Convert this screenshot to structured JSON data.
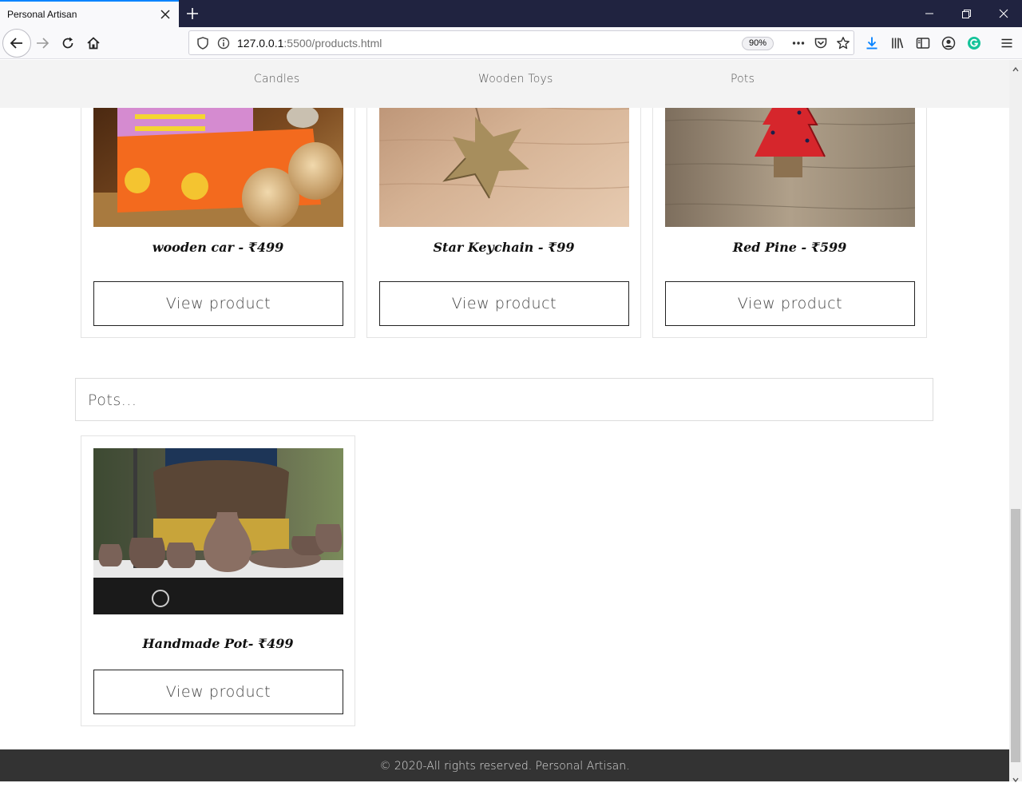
{
  "browser": {
    "tab_title": "Personal Artisan",
    "url_host": "127.0.0.1",
    "url_path": ":5500/products.html",
    "zoom": "90%"
  },
  "nav": {
    "items": [
      "Candles",
      "Wooden Toys",
      "Pots"
    ]
  },
  "products_top": [
    {
      "title": "wooden car - ₹499",
      "button": "View product"
    },
    {
      "title": "Star Keychain - ₹99",
      "button": "View product"
    },
    {
      "title": "Red Pine - ₹599",
      "button": "View product"
    }
  ],
  "pots_section": {
    "heading": "Pots...",
    "products": [
      {
        "title": "Handmade Pot- ₹499",
        "button": "View product"
      }
    ]
  },
  "footer": {
    "text": "© 2020-All rights reserved. Personal Artisan."
  },
  "colors": {
    "chrome_dark": "#202340",
    "accent_blue": "#0a84ff",
    "nav_bg": "#f3f3f3",
    "footer_bg": "#333333"
  }
}
